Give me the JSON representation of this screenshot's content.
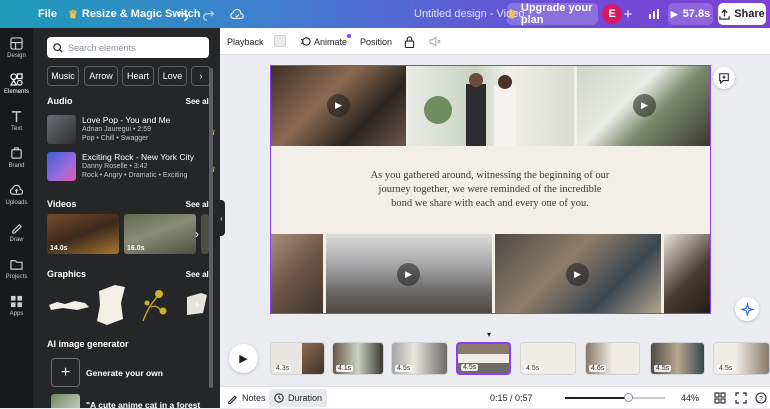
{
  "topbar": {
    "file": "File",
    "resize": "Resize & Magic Switch",
    "title": "Untitled design - Video",
    "upgrade": "Upgrade your plan",
    "avatar": "E",
    "duration": "57.8s",
    "share": "Share"
  },
  "rail": [
    {
      "label": "Design",
      "icon": "design-icon"
    },
    {
      "label": "Elements",
      "icon": "elements-icon"
    },
    {
      "label": "Text",
      "icon": "text-icon"
    },
    {
      "label": "Brand",
      "icon": "brand-icon"
    },
    {
      "label": "Uploads",
      "icon": "uploads-icon"
    },
    {
      "label": "Draw",
      "icon": "draw-icon"
    },
    {
      "label": "Projects",
      "icon": "projects-icon"
    },
    {
      "label": "Apps",
      "icon": "apps-icon"
    }
  ],
  "panel": {
    "search_placeholder": "Search elements",
    "chips": [
      "Music",
      "Arrow",
      "Heart",
      "Love"
    ],
    "audio_title": "Audio",
    "see_all": "See all",
    "tracks": [
      {
        "title": "Love Pop - You and Me",
        "meta": "Adrian Jauregui • 2:59",
        "tags": "Pop • Chill • Swagger"
      },
      {
        "title": "Exciting Rock - New York City",
        "meta": "Danny Roselle • 3:42",
        "tags": "Rock • Angry • Dramatic • Exciting"
      }
    ],
    "videos_title": "Videos",
    "videos": [
      {
        "duration": "14.0s"
      },
      {
        "duration": "16.0s"
      }
    ],
    "graphics_title": "Graphics",
    "ai_title": "AI image generator",
    "generate": "Generate your own",
    "prompt": "\"A cute anime cat in a forest"
  },
  "context": {
    "playback": "Playback",
    "animate": "Animate",
    "position": "Position"
  },
  "canvas": {
    "quote": "As you gathered around, witnessing the beginning of our journey together, we were reminded of the incredible bond we share with each and every one of you."
  },
  "timeline": {
    "clips": [
      "4.3s",
      "4.1s",
      "4.5s",
      "4.5s",
      "4.5s",
      "4.6s",
      "4.5s",
      "4.5s"
    ]
  },
  "bottombar": {
    "notes": "Notes",
    "duration": "Duration",
    "time": "0:15 / 0:57",
    "zoom": "44%"
  },
  "colors": {
    "accent": "#8b3dff",
    "panel": "#252627",
    "rail": "#18191b"
  }
}
